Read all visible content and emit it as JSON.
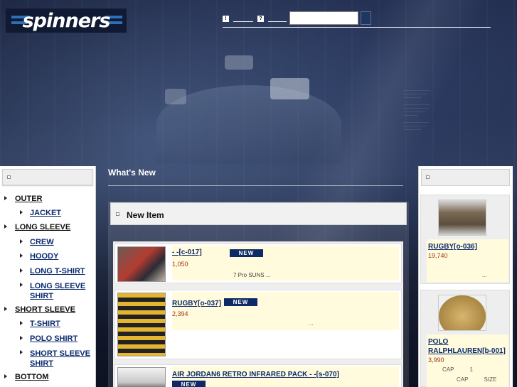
{
  "header": {
    "logo_text": "spinners",
    "nav_items": [
      {
        "icon": "!",
        "label": ""
      },
      {
        "icon": "?",
        "label": ""
      }
    ],
    "search_placeholder": ""
  },
  "left_sidebar": {
    "categories": [
      {
        "label": "OUTER",
        "level": 0
      },
      {
        "label": "JACKET",
        "level": 1
      },
      {
        "label": "LONG SLEEVE",
        "level": 0
      },
      {
        "label": "CREW",
        "level": 1
      },
      {
        "label": "HOODY",
        "level": 1
      },
      {
        "label": "LONG T-SHIRT",
        "level": 1
      },
      {
        "label": "LONG SLEEVE SHIRT",
        "level": 1
      },
      {
        "label": "SHORT SLEEVE",
        "level": 0
      },
      {
        "label": "T-SHIRT",
        "level": 1
      },
      {
        "label": "POLO SHIRT",
        "level": 1
      },
      {
        "label": "SHORT SLEEVE SHIRT",
        "level": 1
      },
      {
        "label": "BOTTOM",
        "level": 0
      }
    ]
  },
  "main": {
    "title": "What's New",
    "section_title": "New Item",
    "items": [
      {
        "name": "-     -[c-017]",
        "badge": "NEW",
        "price": "1,050",
        "desc": "7                    Pro          SUNS ..."
      },
      {
        "name": "RUGBY[o-037]",
        "badge": "NEW",
        "price": "2,394",
        "desc": "..."
      },
      {
        "name": "AIR JORDAN6 RETRO INFRARED PACK -            -[s-070]",
        "badge": "NEW",
        "price": "",
        "desc": ""
      }
    ]
  },
  "right_sidebar": {
    "items": [
      {
        "name": "RUGBY[o-036]",
        "price": "19,740",
        "note": "..."
      },
      {
        "name": "POLO RALPHLAUREN[b-001]",
        "price": "3,990",
        "note_line1": "CAP          1",
        "note_line2": "CAP          SIZE"
      }
    ]
  },
  "colors": {
    "accent_blue": "#0b2a6e",
    "price_red": "#a0361a",
    "badge_bg": "#0c2a66",
    "info_bg": "#fffbdc"
  }
}
